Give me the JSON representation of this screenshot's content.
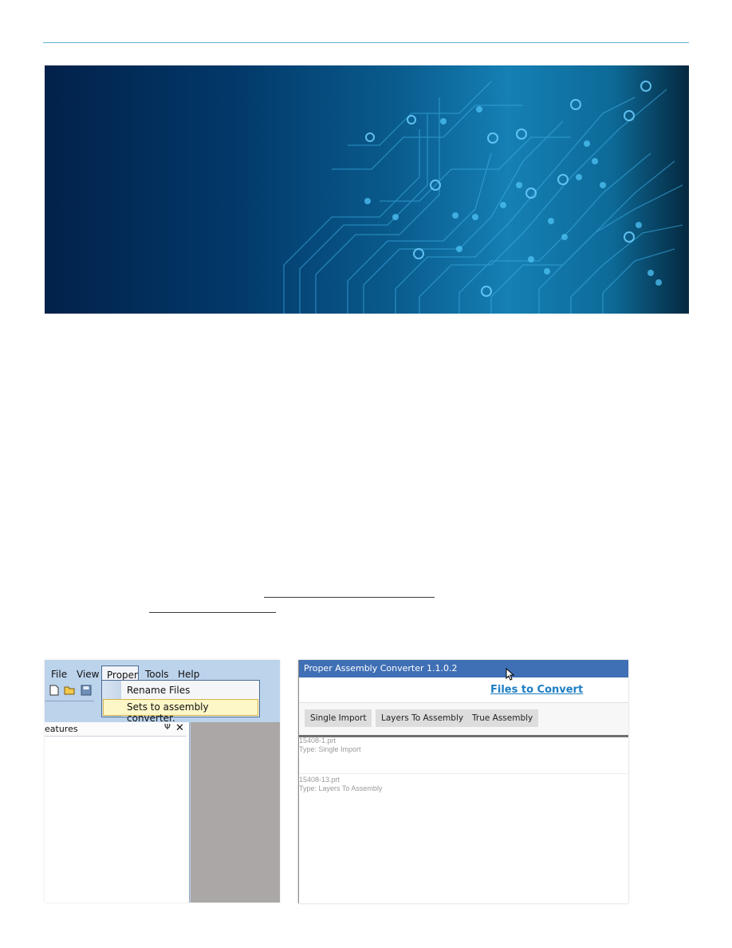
{
  "left_app": {
    "menu": [
      "File",
      "View",
      "Proper",
      "Tools",
      "Help"
    ],
    "dropdown": [
      "Rename Files",
      "Sets to assembly converter."
    ],
    "panel_title": "eatures",
    "pin_glyph": "Ψ",
    "close_glyph": "✕"
  },
  "converter": {
    "title": "Proper Assembly Converter 1.1.0.2",
    "files_link": "Files to Convert",
    "buttons": [
      "Single Import",
      "Layers To Assembly",
      "True Assembly"
    ],
    "entries": [
      {
        "name": "15408-1.prt",
        "type": "Type: Single Import"
      },
      {
        "name": "15408-13.prt",
        "type": "Type: Layers To Assembly"
      }
    ]
  },
  "colors": {
    "rule": "#5fb3d6",
    "banner_dark": "#02214a",
    "banner_light": "#1580b4",
    "titlebar": "#3f6fb5",
    "link": "#1d7ec3"
  }
}
